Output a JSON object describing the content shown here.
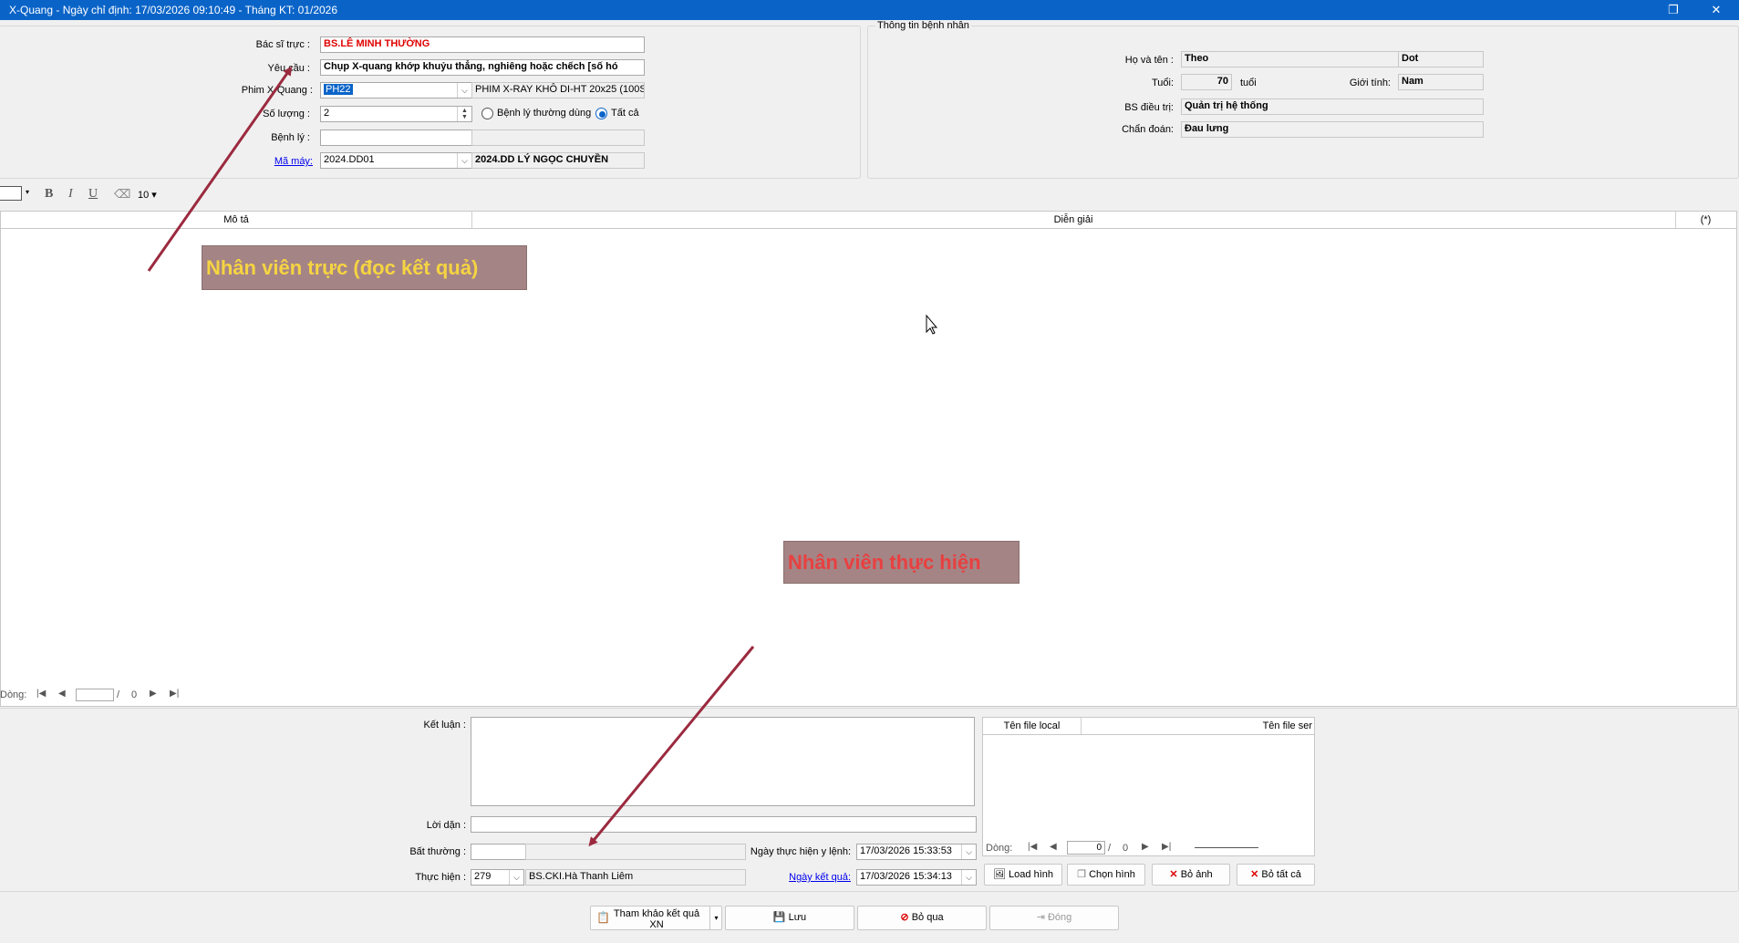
{
  "window": {
    "title": "X-Quang - Ngày chỉ định: 17/03/2026 09:10:49 - Tháng KT: 01/2026",
    "restore_glyph": "❐",
    "close_glyph": "✕"
  },
  "form": {
    "bac_si_truc": {
      "label": "Bác sĩ trực :",
      "value": "BS.LÊ MINH THƯỜNG"
    },
    "yeu_cau": {
      "label": "Yêu cầu :",
      "value": "Chụp X-quang khớp khuỷu thẳng, nghiêng hoặc chếch [số hó"
    },
    "phim": {
      "label": "Phim X-Quang :",
      "code": "PH22",
      "name": "PHIM X-RAY KHÔ DI-HT 20x25 (100S"
    },
    "so_luong": {
      "label": "Số lượng :",
      "value": "2"
    },
    "benh_ly_radio": [
      {
        "label": "Bệnh lý thường dùng",
        "checked": false
      },
      {
        "label": "Tất cả",
        "checked": true
      }
    ],
    "benh_ly": {
      "label": "Bệnh lý :",
      "value": ""
    },
    "ma_may": {
      "label": "Mã máy:",
      "code": "2024.DD01",
      "name": "2024.DD LÝ NGỌC CHUYỀN"
    }
  },
  "patient": {
    "group_title": "Thông tin bệnh nhân",
    "ho_ten": {
      "label": "Họ và tên :",
      "last": "Theo",
      "first": "Dot"
    },
    "tuoi": {
      "label": "Tuổi:",
      "value": "70",
      "unit": "tuổi"
    },
    "gioi_tinh": {
      "label": "Giới tính:",
      "value": "Nam"
    },
    "bs_dieu_tri": {
      "label": "BS điều trị:",
      "value": "Quản trị hệ thống"
    },
    "chan_doan": {
      "label": "Chẩn đoán:",
      "value": "Đau lưng"
    }
  },
  "toolbar": {
    "bold": "B",
    "italic": "I",
    "underline": "U",
    "font_size": "10"
  },
  "grid": {
    "columns": [
      "Mô tả",
      "Diễn giải",
      "(*)"
    ],
    "nav_label": "Dòng:",
    "nav_sep": "/",
    "nav_total": "0"
  },
  "bottom": {
    "ket_luan": {
      "label": "Kết luận :",
      "value": ""
    },
    "loi_dan": {
      "label": "Lời dặn :",
      "value": ""
    },
    "bat_thuong": {
      "label": "Bất thường :",
      "value": ""
    },
    "thuc_hien": {
      "label": "Thực hiện :",
      "code": "279",
      "name": "BS.CKI.Hà Thanh Liêm"
    },
    "ngay_thuc_hien": {
      "label": "Ngày thực hiện y lệnh:",
      "value": "17/03/2026 15:33:53"
    },
    "ngay_ket_qua": {
      "label": "Ngày kết quả:",
      "value": "17/03/2026 15:34:13"
    }
  },
  "files": {
    "columns": [
      "Tên file local",
      "Tên file ser"
    ],
    "nav_label": "Dòng:",
    "nav_value": "0",
    "nav_sep": "/",
    "nav_total": "0"
  },
  "image_buttons": {
    "load": "Load hình",
    "chon": "Chọn hình",
    "bo_anh": "Bỏ ảnh",
    "bo_tat_ca": "Bỏ tất cả"
  },
  "footer": {
    "tham_khao": "Tham khảo kết quả XN",
    "luu": "Lưu",
    "bo_qua": "Bỏ qua",
    "dong": "Đóng"
  },
  "annotations": {
    "nv_truc": "Nhân viên trực (đọc kết quả)",
    "nv_thuc_hien": "Nhân viên thực hiện",
    "arrow_color": "#9b2a3f",
    "box_color": "#a58486",
    "text_yellow": "#f5d442",
    "text_red": "#e84040"
  }
}
